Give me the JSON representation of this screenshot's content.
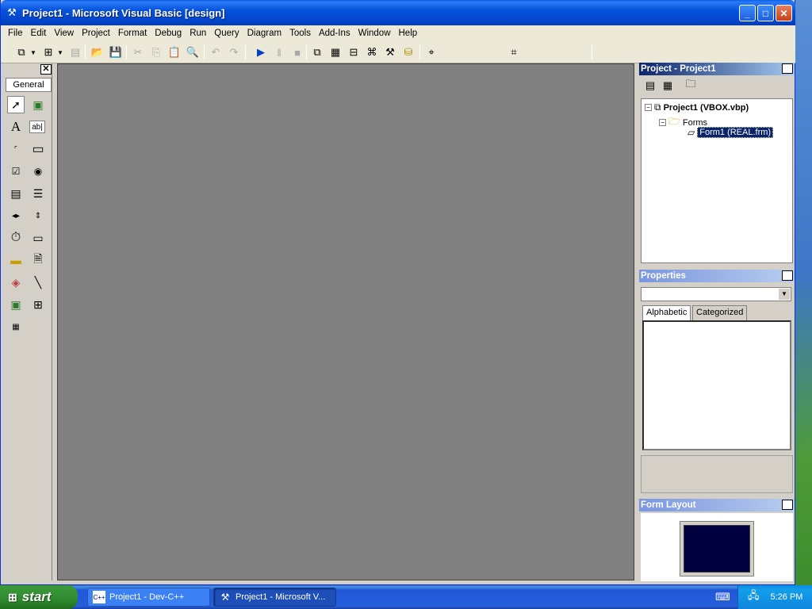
{
  "window": {
    "title": "Project1 - Microsoft Visual Basic [design]",
    "buttons": {
      "minimize": "_",
      "maximize": "□",
      "close": "✕"
    }
  },
  "menu": [
    "File",
    "Edit",
    "View",
    "Project",
    "Format",
    "Debug",
    "Run",
    "Query",
    "Diagram",
    "Tools",
    "Add-Ins",
    "Window",
    "Help"
  ],
  "toolbox": {
    "tab_label": "General",
    "close": "✕"
  },
  "project_explorer": {
    "title": "Project - Project1",
    "close": "✕",
    "tree": {
      "project": "Project1 (VBOX.vbp)",
      "folder": "Forms",
      "form": "Form1 (REAL.frm)"
    }
  },
  "properties": {
    "title": "Properties",
    "close": "✕",
    "object_combo": "",
    "tabs": [
      "Alphabetic",
      "Categorized"
    ],
    "active_tab": "Alphabetic"
  },
  "form_layout": {
    "title": "Form Layout",
    "close": "✕"
  },
  "taskbar": {
    "start_label": "start",
    "tasks": [
      {
        "label": "Project1 - Dev-C++",
        "icon": "dev-cpp-icon",
        "active": false
      },
      {
        "label": "Project1 - Microsoft V...",
        "icon": "vb-icon",
        "active": true
      }
    ],
    "clock": "5:26 PM"
  },
  "colors": {
    "titlebar": "#0553dc",
    "workspace": "#808080",
    "panel_header_active": "#0a246a",
    "selection": "#0a246a",
    "form_layout_screen": "#000040"
  }
}
